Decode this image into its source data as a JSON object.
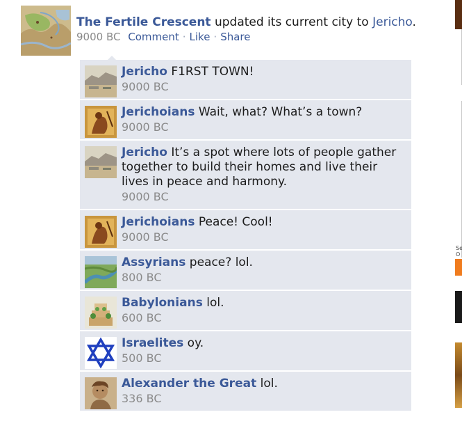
{
  "post": {
    "author": "The Fertile Crescent",
    "action_text": " updated its current city to ",
    "city": "Jericho",
    "punct": ".",
    "date": "9000 BC",
    "actions": [
      "Comment",
      "Like",
      "Share"
    ]
  },
  "comments": [
    {
      "name": "Jericho",
      "text": " F1RST TOWN!",
      "date": "9000 BC",
      "avatar_icon": "jericho-landscape-icon"
    },
    {
      "name": "Jerichoians",
      "text": " Wait, what? What’s a town?",
      "date": "9000 BC",
      "avatar_icon": "ancient-painting-icon"
    },
    {
      "name": "Jericho",
      "text": " It’s a spot where lots of people gather together to build their homes and live their lives in peace and harmony.",
      "date": "9000 BC",
      "avatar_icon": "jericho-landscape-icon"
    },
    {
      "name": "Jerichoians",
      "text": " Peace! Cool!",
      "date": "9000 BC",
      "avatar_icon": "ancient-painting-icon"
    },
    {
      "name": "Assyrians",
      "text": " peace? lol.",
      "date": "800 BC",
      "avatar_icon": "river-valley-icon"
    },
    {
      "name": "Babylonians",
      "text": " lol.",
      "date": "600 BC",
      "avatar_icon": "hanging-gardens-icon"
    },
    {
      "name": "Israelites",
      "text": " oy.",
      "date": "500 BC",
      "avatar_icon": "star-of-david-icon"
    },
    {
      "name": "Alexander the Great",
      "text": " lol.",
      "date": "336 BC",
      "avatar_icon": "mosaic-portrait-icon"
    }
  ],
  "right_edge": {
    "fragment_text": [
      "Se",
      "O"
    ]
  },
  "colors": {
    "link": "#3b5998",
    "comment_bg": "#e4e7ee",
    "muted": "#8a8a8a"
  }
}
